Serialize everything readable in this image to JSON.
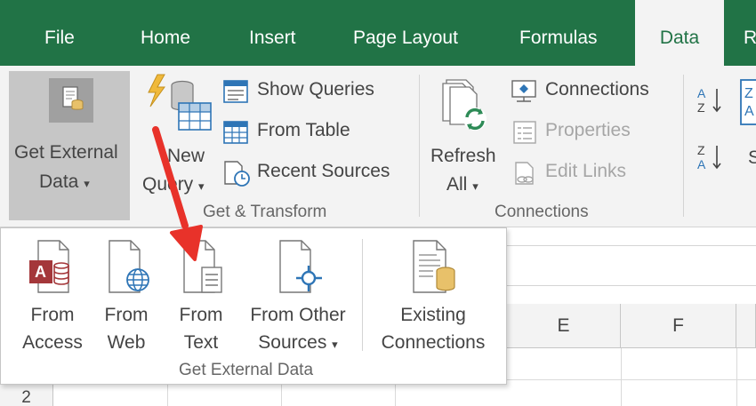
{
  "tabs": [
    "File",
    "Home",
    "Insert",
    "Page Layout",
    "Formulas",
    "Data",
    "R"
  ],
  "ribbon": {
    "get_external": {
      "line1": "Get External",
      "line2": "Data",
      "caret": "▾"
    },
    "new_query": {
      "line1": "New",
      "line2": "Query",
      "caret": "▾"
    },
    "show_queries": "Show Queries",
    "from_table": "From Table",
    "recent_sources": "Recent Sources",
    "get_transform_label": "Get & Transform",
    "refresh": {
      "line1": "Refresh",
      "line2": "All",
      "caret": "▾"
    },
    "connections": "Connections",
    "properties": "Properties",
    "edit_links": "Edit Links",
    "connections_label": "Connections",
    "sort_partial": "S"
  },
  "dropdown": {
    "items": [
      {
        "line1": "From",
        "line2": "Access"
      },
      {
        "line1": "From",
        "line2": "Web"
      },
      {
        "line1": "From",
        "line2": "Text"
      },
      {
        "line1": "From Other",
        "line2": "Sources",
        "caret": "▾"
      },
      {
        "line1": "Existing",
        "line2": "Connections"
      }
    ],
    "group_label": "Get External Data"
  },
  "sheet": {
    "columns": [
      "E",
      "F"
    ],
    "rows": [
      "2"
    ]
  },
  "colors": {
    "tab_bar": "#217346",
    "ribbon": "#f3f3f3",
    "access_red": "#a4373a",
    "web_blue": "#2e75b6",
    "db_gold": "#e8c16a",
    "pointer_arrow": "#e8322a"
  }
}
